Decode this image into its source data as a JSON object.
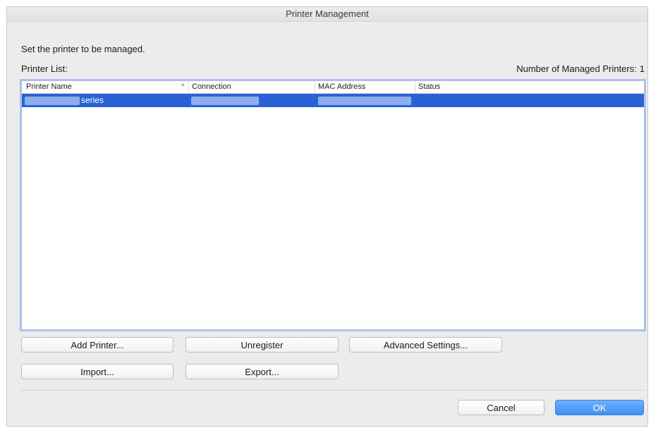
{
  "window": {
    "title": "Printer Management"
  },
  "instruction": "Set the printer to be managed.",
  "printer_list": {
    "label": "Printer List:",
    "managed_count_label": "Number of Managed Printers:",
    "managed_count": "1",
    "columns": [
      "Printer Name",
      "Connection",
      "MAC Address",
      "Status"
    ],
    "sort_indicator": "^",
    "rows": [
      {
        "name": "series",
        "connection": "",
        "mac": "",
        "status": "",
        "selected": true
      }
    ]
  },
  "buttons": {
    "add_printer": "Add Printer...",
    "unregister": "Unregister",
    "advanced_settings": "Advanced Settings...",
    "import": "Import...",
    "export": "Export...",
    "cancel": "Cancel",
    "ok": "OK"
  },
  "colors": {
    "selection": "#2a62d6",
    "focus_ring": "#a9c2e6",
    "ok_button": "#3e8ef5"
  }
}
